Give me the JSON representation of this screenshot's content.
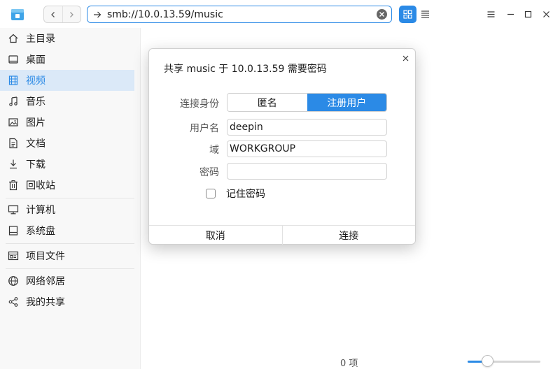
{
  "address": {
    "value": "smb://10.0.13.59/music"
  },
  "sidebar": {
    "items": [
      {
        "label": "主目录",
        "icon": "home-icon"
      },
      {
        "label": "桌面",
        "icon": "desktop-icon"
      },
      {
        "label": "视频",
        "icon": "video-icon",
        "selected": true
      },
      {
        "label": "音乐",
        "icon": "music-icon"
      },
      {
        "label": "图片",
        "icon": "picture-icon"
      },
      {
        "label": "文档",
        "icon": "document-icon"
      },
      {
        "label": "下载",
        "icon": "download-icon"
      },
      {
        "label": "回收站",
        "icon": "trash-icon"
      },
      {
        "label": "计算机",
        "icon": "computer-icon"
      },
      {
        "label": "系统盘",
        "icon": "disk-icon"
      },
      {
        "label": "项目文件",
        "icon": "project-folder-icon"
      },
      {
        "label": "网络邻居",
        "icon": "network-icon"
      },
      {
        "label": "我的共享",
        "icon": "share-icon"
      }
    ]
  },
  "status": {
    "item_count": "0 项",
    "icon_size_fraction": 0.27
  },
  "dialog": {
    "title": "共享 music 于 10.0.13.59 需要密码",
    "identity_label": "连接身份",
    "identity_options": [
      "匿名",
      "注册用户"
    ],
    "identity_selected": "注册用户",
    "username_label": "用户名",
    "username_value": "deepin",
    "domain_label": "域",
    "domain_value": "WORKGROUP",
    "password_label": "密码",
    "password_value": "",
    "remember_label": "记住密码",
    "remember_checked": false,
    "cancel_label": "取消",
    "connect_label": "连接"
  },
  "colors": {
    "accent": "#2b8ae6",
    "selected_bg": "#dbe9f8"
  }
}
